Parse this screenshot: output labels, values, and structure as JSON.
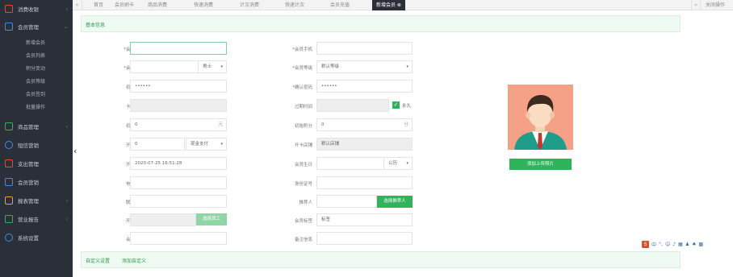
{
  "sidebar": {
    "items": [
      {
        "label": "消费收银",
        "icon": "cashier-icon",
        "color": "#e14d2a",
        "active": false
      },
      {
        "label": "会员管理",
        "icon": "member-icon",
        "color": "#3a8ee6",
        "active": true
      },
      {
        "label": "商品管理",
        "icon": "goods-icon",
        "color": "#2fb35b"
      },
      {
        "label": "短信营销",
        "icon": "sms-icon",
        "color": "#3a8ee6"
      },
      {
        "label": "支出管理",
        "icon": "expense-icon",
        "color": "#e14d2a"
      },
      {
        "label": "会员营销",
        "icon": "marketing-icon",
        "color": "#3a8ee6"
      },
      {
        "label": "报表管理",
        "icon": "report-icon",
        "color": "#e6a23c"
      },
      {
        "label": "营业报告",
        "icon": "chart-icon",
        "color": "#2fb35b"
      },
      {
        "label": "系统设置",
        "icon": "settings-icon",
        "color": "#3a8ee6"
      }
    ],
    "sub_items": [
      "新增会员",
      "会员列表",
      "积分变动",
      "会员等级",
      "会员签到",
      "批量操作"
    ]
  },
  "tabs": {
    "prev": "«",
    "next": "»",
    "items": [
      "首页",
      "会员刷卡",
      "商品消费",
      "快速消费",
      "计次消费",
      "快速计次",
      "会员充值",
      "新增会员"
    ],
    "active_index": 7,
    "close_all": "关闭操作"
  },
  "section_title": "基本信息",
  "form": {
    "card_no_label": "*会员卡号",
    "phone_label": "*会员手机",
    "name_label": "*会员姓名",
    "gender_value": "男士",
    "level_label": "*会员等级",
    "level_value": "默认等级",
    "password_label": "初始密码",
    "password_value": "••••••",
    "confirm_label": "*确认密码",
    "confirm_value": "••••••",
    "face_label": "卡面号码",
    "expire_label": "过期时间",
    "permanent_label": "永久",
    "balance_label": "初始余额",
    "balance_value": "0",
    "balance_unit": "元",
    "points_label": "初始积分",
    "points_value": "0",
    "points_unit": "分",
    "fee_label": "开卡费用",
    "fee_value": "0",
    "pay_method": "现金支付",
    "shop_label": "开卡店铺",
    "shop_value": "默认店铺",
    "open_date_label": "开卡日期",
    "open_date_value": "2020-07-25 16:51:28",
    "birthday_label": "会员生日",
    "birthday_type": "公历",
    "email_label": "电子邮箱",
    "idcard_label": "身份证号",
    "address_label": "联系地址",
    "referrer_label": "推荐人",
    "referrer_button": "选择推荐人",
    "staff_label": "开卡人员",
    "staff_button": "选择员工",
    "tags_label": "会员标签",
    "tags_value": "标签",
    "note_label": "会员备注",
    "remark_label": "备注信息"
  },
  "upload_button": "添加上传照片",
  "footer": {
    "custom_link": "自定义设置",
    "add_custom_link": "添加自定义"
  },
  "ime": {
    "logo": "S",
    "label": "中"
  }
}
